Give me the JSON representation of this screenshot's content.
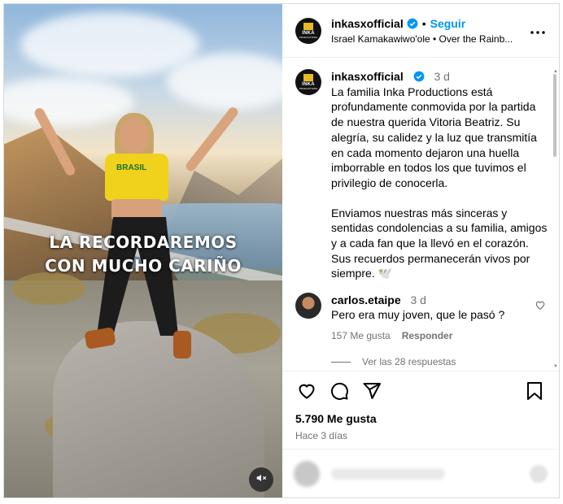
{
  "post": {
    "overlay_line1": "LA RECORDAREMOS",
    "overlay_line2": "CON MUCHO CARIÑO",
    "shirt_text": "BRASIL"
  },
  "header": {
    "username": "inkasxofficial",
    "separator": "•",
    "follow_label": "Seguir",
    "audio": "Israel Kamakawiwo'ole • Over the Rainb...",
    "avatar_text": "INKA",
    "avatar_subtext": "PRODUCTIONS"
  },
  "caption": {
    "username": "inkasxofficial",
    "time": "3 d",
    "paragraph1": "La familia Inka Productions está profundamente conmovida por la partida de nuestra querida Vitoria Beatriz. Su alegría, su calidez y la luz que transmitía en cada momento dejaron una huella imborrable en todos los que tuvimos el privilegio de conocerla.",
    "paragraph2": "Enviamos nuestras más sinceras y sentidas condolencias a su familia, amigos y a cada fan que la llevó en el corazón. Sus recuerdos permanecerán vivos por siempre. 🕊️"
  },
  "comment": {
    "username": "carlos.etaipe",
    "time": "3 d",
    "text": "Pero era muy joven, que le pasó ?",
    "likes": "157 Me gusta",
    "reply_label": "Responder",
    "view_replies": "Ver las 28 respuestas"
  },
  "footer": {
    "likes": "5.790 Me gusta",
    "date": "Hace 3 días"
  },
  "colors": {
    "accent": "#0095f6",
    "verified": "#0095f6",
    "muted_text": "#737373"
  },
  "icons": [
    "verified-icon",
    "more-icon",
    "heart-icon",
    "comment-icon",
    "share-icon",
    "bookmark-icon",
    "mute-icon"
  ]
}
